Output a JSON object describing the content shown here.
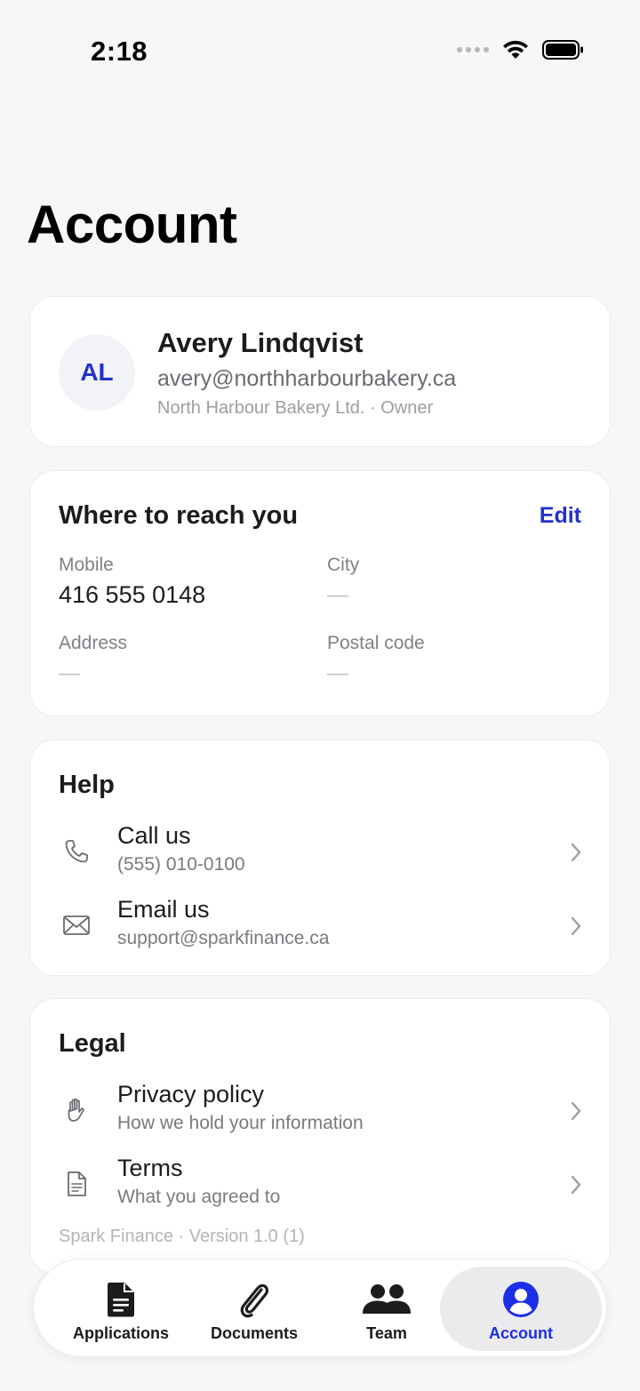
{
  "status_bar": {
    "time": "2:18"
  },
  "page": {
    "title": "Account"
  },
  "profile": {
    "initials": "AL",
    "name": "Avery Lindqvist",
    "email": "avery@northharbourbakery.ca",
    "org_role": "North Harbour Bakery Ltd. · Owner"
  },
  "reach": {
    "heading": "Where to reach you",
    "edit_label": "Edit",
    "mobile_label": "Mobile",
    "mobile_value": "416 555 0148",
    "city_label": "City",
    "city_value": "—",
    "address_label": "Address",
    "address_value": "—",
    "postal_label": "Postal code",
    "postal_value": "—"
  },
  "help": {
    "heading": "Help",
    "items": [
      {
        "title": "Call us",
        "subtitle": "(555) 010-0100",
        "icon": "phone-icon"
      },
      {
        "title": "Email us",
        "subtitle": "support@sparkfinance.ca",
        "icon": "envelope-icon"
      }
    ]
  },
  "legal": {
    "heading": "Legal",
    "items": [
      {
        "title": "Privacy policy",
        "subtitle": "How we hold your information",
        "icon": "hand-icon"
      },
      {
        "title": "Terms",
        "subtitle": "What you agreed to",
        "icon": "document-icon"
      }
    ],
    "version": "Spark Finance · Version 1.0 (1)"
  },
  "tabs": [
    {
      "label": "Applications",
      "icon": "file-icon",
      "active": false
    },
    {
      "label": "Documents",
      "icon": "paperclip-icon",
      "active": false
    },
    {
      "label": "Team",
      "icon": "people-icon",
      "active": false
    },
    {
      "label": "Account",
      "icon": "person-circle-icon",
      "active": true
    }
  ],
  "colors": {
    "accent": "#2332c7",
    "active_tab": "#1d2ee8",
    "background": "#f7f7f8"
  }
}
